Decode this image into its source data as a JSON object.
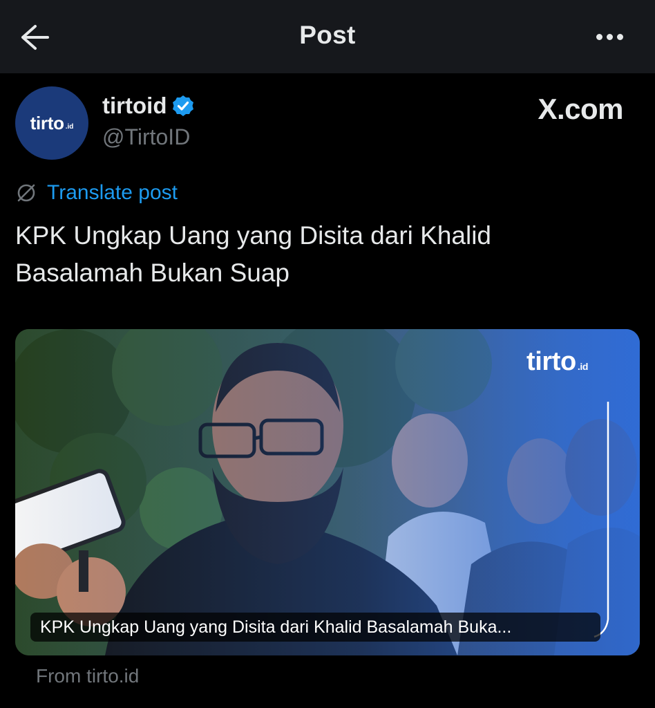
{
  "header": {
    "title": "Post",
    "back_icon": "arrow-left-icon",
    "more_icon": "more-horizontal-icon"
  },
  "author": {
    "avatar_text": "tirto",
    "avatar_sub": ".id",
    "display_name": "tirtoid",
    "verified_icon": "verified-badge-icon",
    "handle": "@TirtoID",
    "avatar_color": "#1b3a7a",
    "verified_color": "#1d9bf0"
  },
  "source": {
    "label": "X.com"
  },
  "translate": {
    "label": "Translate post",
    "icon": "translate-globe-icon",
    "color": "#1d9bf0"
  },
  "post": {
    "text": "KPK Ungkap Uang yang Disita dari Khalid Basalamah Bukan Suap"
  },
  "card": {
    "logo_text": "tirto",
    "logo_sub": ".id",
    "caption": "KPK Ungkap Uang yang Disita dari Khalid Basalamah Buka...",
    "from": "From tirto.id"
  }
}
